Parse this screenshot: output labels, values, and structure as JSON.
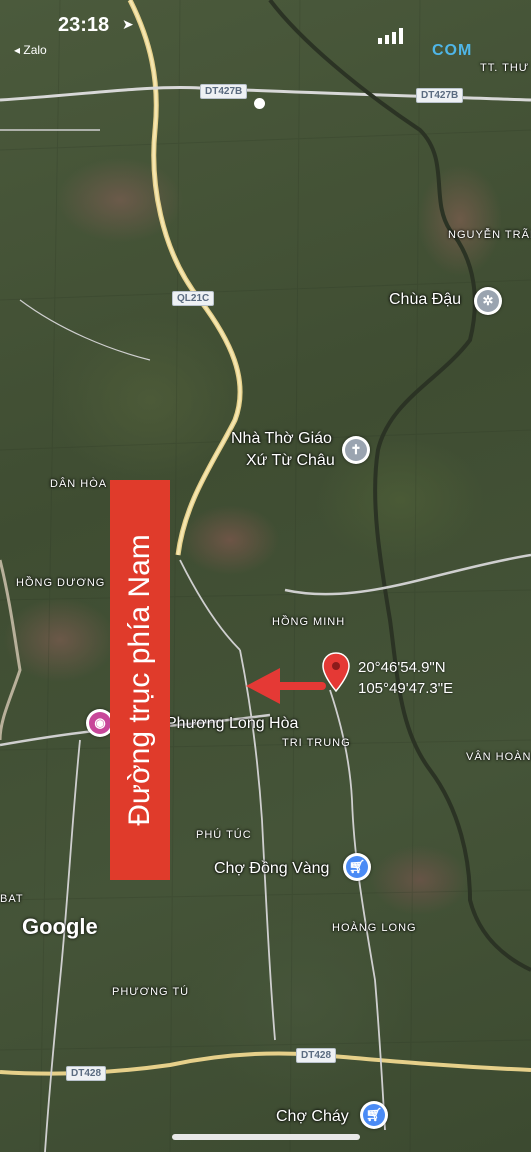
{
  "status_bar": {
    "time": "23:18",
    "back_label": "◂ Zalo"
  },
  "watermark": "COM",
  "banner": {
    "text": "Đường trục phía Nam",
    "color": "#e03b2b"
  },
  "pin": {
    "lat": "20°46'54.9\"N",
    "lng": "105°49'47.3\"E",
    "color": "#e53935"
  },
  "road_shields": {
    "dt427b_1": "DT427B",
    "dt427b_2": "DT427B",
    "ql21c": "QL21C",
    "dt428_1": "DT428",
    "dt428_2": "DT428"
  },
  "places": {
    "tt_thu": "TT. THƯ",
    "nguyen_trai": "NGUYỄN TRÃI",
    "chua_dau": "Chùa Đậu",
    "nha_tho_1": "Nhà Thờ Giáo",
    "nha_tho_2": "Xứ Từ Châu",
    "dan_hoa": "DÂN HÒA",
    "hong_duong": "HỒNG DƯƠNG",
    "hong_minh": "HỒNG MINH",
    "phuong_long_hoa": "Phương Long Hòa",
    "tri_trung": "TRI TRUNG",
    "van_hoang": "VÂN HOÀN",
    "phu_tuc": "PHÚ TÚC",
    "cho_dong_vang": "Chợ Đồng Vàng",
    "bat": "BAT",
    "hoang_long": "HOÀNG LONG",
    "phuong_tu": "PHƯƠNG TÚ",
    "cho_chay": "Chợ Cháy"
  },
  "google_logo": "Google",
  "colors": {
    "poi_temple": "#9aa4b0",
    "poi_church": "#9aa4b0",
    "poi_shop": "#4a8bf5",
    "poi_photo": "#c8479a"
  }
}
